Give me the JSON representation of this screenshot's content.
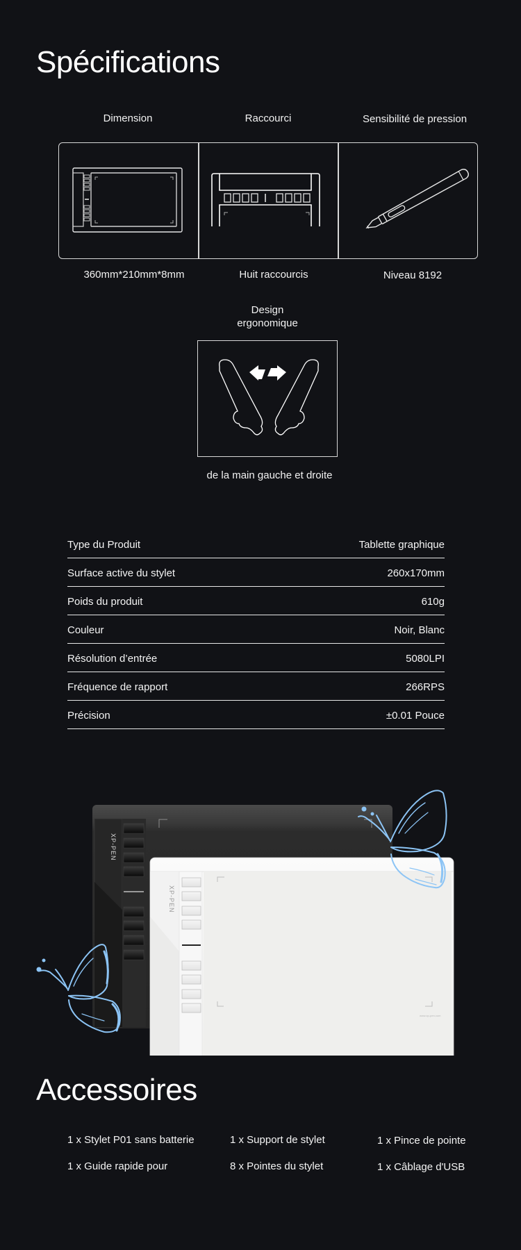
{
  "specs_section": {
    "title": "Spécifications",
    "features": [
      {
        "label": "Dimension",
        "value": "360mm*210mm*8mm",
        "icon": "tablet-outline-icon"
      },
      {
        "label": "Raccourci",
        "value": "Huit raccourcis",
        "icon": "shortcut-keys-icon"
      },
      {
        "label": "Sensibilité de pression",
        "value": "Niveau 8192",
        "icon": "stylus-pen-icon"
      }
    ],
    "ergonomic": {
      "label_line1": "Design",
      "label_line2": "ergonomique",
      "value": "de la main gauche et droite",
      "icon": "left-right-hand-icon"
    },
    "table": [
      {
        "key": "Type du Produit",
        "value": "Tablette graphique"
      },
      {
        "key": "Surface active du stylet",
        "value": "260x170mm"
      },
      {
        "key": "Poids du produit",
        "value": "610g"
      },
      {
        "key": "Couleur",
        "value": "Noir, Blanc"
      },
      {
        "key": "Résolution d’entrée",
        "value": "5080LPI"
      },
      {
        "key": "Fréquence de rapport",
        "value": "266RPS"
      },
      {
        "key": "Précision",
        "value": "±0.01 Pouce"
      }
    ]
  },
  "product_image": {
    "brand_text": "XP-PEN",
    "website_text": "www.xp-pen.com",
    "accent_color": "#8cc4f5"
  },
  "accessories_section": {
    "title": "Accessoires",
    "items": [
      "1 x Stylet P01 sans batterie",
      "1 x Support de stylet",
      "1 x Pince de pointe",
      "1 x Guide rapide pour",
      "8 x Pointes du stylet",
      "1 x Câblage d'USB"
    ]
  }
}
